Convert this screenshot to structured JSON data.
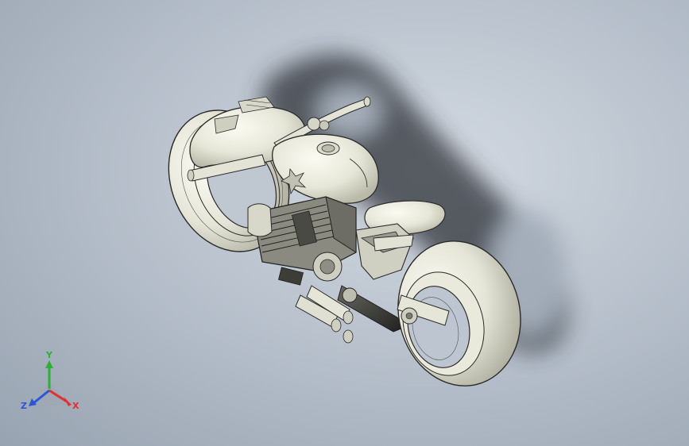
{
  "viewport": {
    "background_top": "#d4dae2",
    "background_bottom": "#98a3b1"
  },
  "model": {
    "body_color": "#e9e9dd",
    "edge_color": "#2a2a2a",
    "shadow_color": "#2e3338"
  },
  "triad": {
    "x_label": "X",
    "y_label": "Y",
    "z_label": "Z",
    "x_color": "#e23030",
    "y_color": "#2fae3a",
    "z_color": "#2d55d8"
  }
}
